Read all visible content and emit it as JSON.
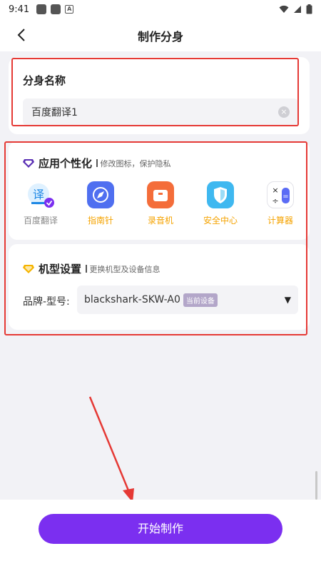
{
  "status": {
    "time": "9:41"
  },
  "header": {
    "title": "制作分身"
  },
  "name_card": {
    "title": "分身名称",
    "input_value": "百度翻译1"
  },
  "personalize": {
    "title": "应用个性化",
    "subtitle": "修改图标，保护隐私",
    "apps": [
      {
        "label": "百度翻译",
        "icon": "baidu-translate-icon",
        "color": "#888888"
      },
      {
        "label": "指南针",
        "icon": "compass-icon",
        "color": "#f5a300"
      },
      {
        "label": "录音机",
        "icon": "recorder-icon",
        "color": "#f5a300"
      },
      {
        "label": "安全中心",
        "icon": "shield-icon",
        "color": "#f5a300"
      },
      {
        "label": "计算器",
        "icon": "calculator-icon",
        "color": "#f5a300"
      }
    ],
    "translate_glyph": "译"
  },
  "device": {
    "title": "机型设置",
    "subtitle": "更换机型及设备信息",
    "brand_label": "品牌-型号:",
    "model_value": "blackshark-SKW-A0",
    "current_badge": "当前设备"
  },
  "actions": {
    "start_label": "开始制作"
  },
  "colors": {
    "accent": "#7b2ff0",
    "highlight": "#e53935",
    "label_orange": "#f5a300"
  }
}
